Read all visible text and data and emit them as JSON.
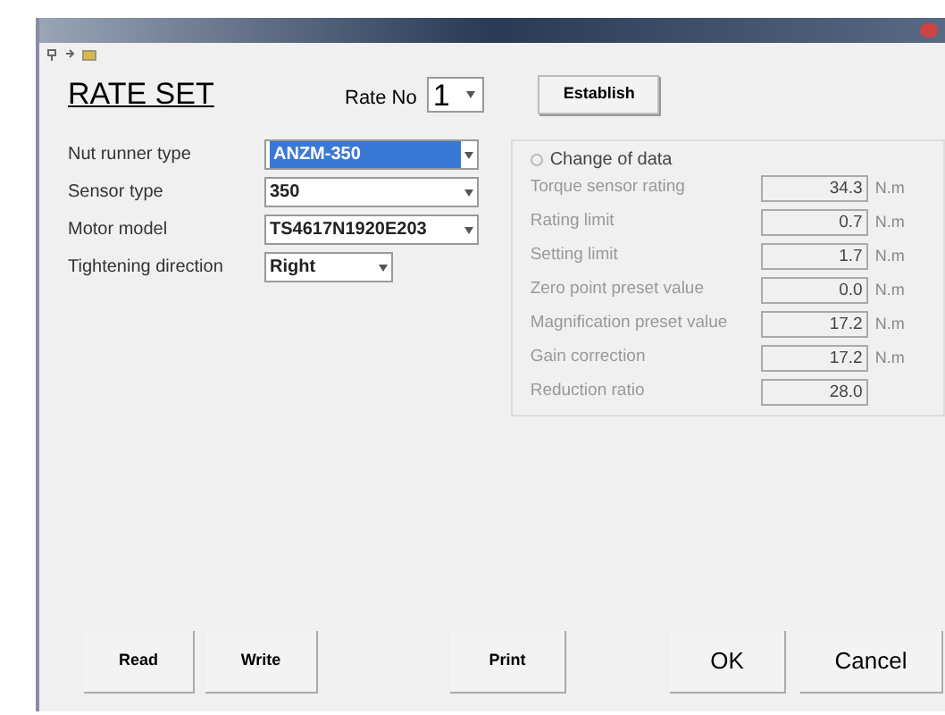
{
  "window": {
    "title": "RATE SET"
  },
  "rate_no": {
    "label": "Rate No",
    "value": "1"
  },
  "establish_button": "Establish",
  "settings": [
    {
      "label": "Nut runner type",
      "value": "ANZM-350",
      "selected": true
    },
    {
      "label": "Sensor type",
      "value": "350",
      "selected": false
    },
    {
      "label": "Motor model",
      "value": "TS4617N1920E203",
      "selected": false
    },
    {
      "label": "Tightening direction",
      "value": "Right",
      "selected": false
    }
  ],
  "change_of_data": {
    "label": "Change of data",
    "checked": false,
    "disabled": true,
    "rows": [
      {
        "label": "Torque sensor rating",
        "value": "34.3",
        "unit": "N.m"
      },
      {
        "label": "Rating limit",
        "value": "0.7",
        "unit": "N.m"
      },
      {
        "label": "Setting limit",
        "value": "1.7",
        "unit": "N.m"
      },
      {
        "label": "Zero point preset value",
        "value": "0.0",
        "unit": "N.m"
      },
      {
        "label": "Magnification preset value",
        "value": "17.2",
        "unit": "N.m"
      },
      {
        "label": "Gain correction",
        "value": "17.2",
        "unit": "N.m"
      },
      {
        "label": "Reduction ratio",
        "value": "28.0"
      }
    ]
  },
  "buttons": [
    {
      "label": "Read",
      "kind": "small"
    },
    {
      "label": "Write",
      "kind": "small"
    },
    {
      "label": "Print",
      "kind": "small"
    },
    {
      "label": "OK",
      "kind": "large"
    },
    {
      "label": "Cancel",
      "kind": "large"
    }
  ]
}
